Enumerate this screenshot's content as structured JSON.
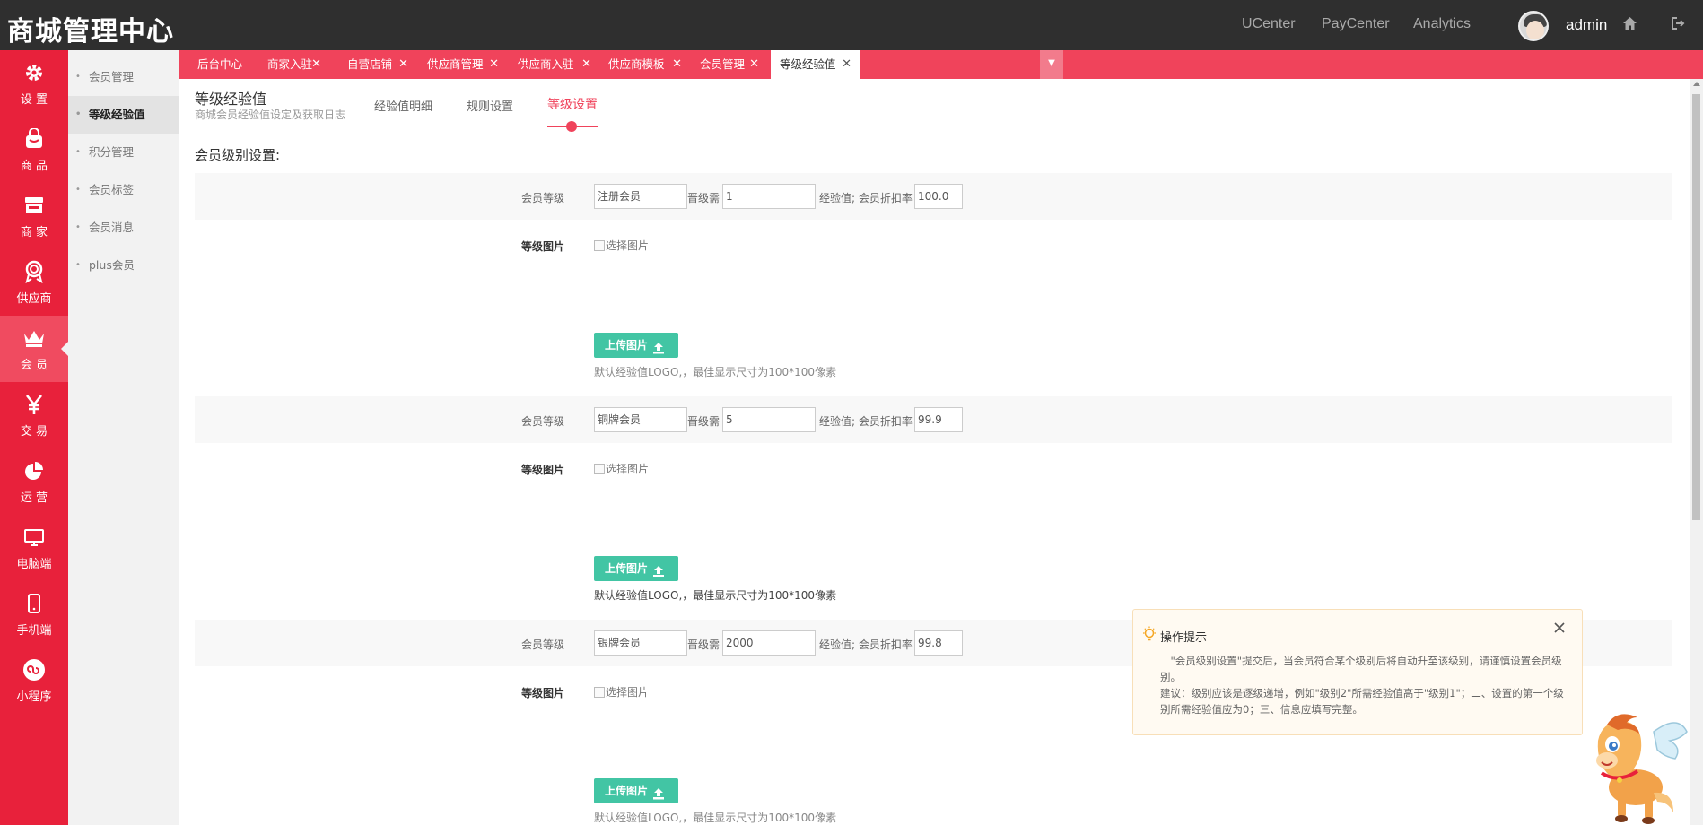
{
  "header": {
    "brand": "商城管理中心",
    "nav": [
      "UCenter",
      "PayCenter",
      "Analytics"
    ],
    "username": "admin"
  },
  "sidebar": {
    "items": [
      {
        "label": "设 置",
        "icon": "gear-icon"
      },
      {
        "label": "商 品",
        "icon": "bag-icon"
      },
      {
        "label": "商 家",
        "icon": "store-icon"
      },
      {
        "label": "供应商",
        "icon": "medal-icon"
      },
      {
        "label": "会 员",
        "icon": "crown-icon"
      },
      {
        "label": "交 易",
        "icon": "yen-icon"
      },
      {
        "label": "运 营",
        "icon": "pie-chart-icon"
      },
      {
        "label": "电脑端",
        "icon": "monitor-icon"
      },
      {
        "label": "手机端",
        "icon": "mobile-icon"
      },
      {
        "label": "小程序",
        "icon": "mini-program-icon"
      }
    ],
    "active_index": 4
  },
  "submenu": {
    "items": [
      "会员管理",
      "等级经验值",
      "积分管理",
      "会员标签",
      "会员消息",
      "plus会员"
    ],
    "active_index": 1
  },
  "tabs": {
    "items": [
      "后台中心",
      "商家入驻",
      "自营店铺",
      "供应商管理",
      "供应商入驻",
      "供应商模板",
      "会员管理",
      "等级经验值"
    ],
    "active_index": 7
  },
  "page": {
    "title": "等级经验值",
    "description": "商城会员经验值设定及获取日志",
    "sub_tabs": [
      "经验值明细",
      "规则设置",
      "等级设置"
    ],
    "active_sub_tab": 2,
    "section_title": "会员级别设置:"
  },
  "form": {
    "level_label": "会员等级",
    "upgrade_label": "晋级需",
    "exp_discount_label": "经验值; 会员折扣率",
    "image_label": "等级图片",
    "image_alt": "选择图片",
    "upload_label": "上传图片",
    "hint": "默认经验值LOGO,，最佳显示尺寸为100*100像素",
    "levels": [
      {
        "name": "注册会员",
        "exp": "1",
        "discount": "100.0"
      },
      {
        "name": "铜牌会员",
        "exp": "5",
        "discount": "99.9"
      },
      {
        "name": "银牌会员",
        "exp": "2000",
        "discount": "99.8"
      }
    ]
  },
  "tip": {
    "title": "操作提示",
    "line1": "\"会员级别设置\"提交后，当会员符合某个级别后将自动升至该级别，请谨慎设置会员级别。",
    "line2": "建议：级别应该是逐级递增，例如\"级别2\"所需经验值高于\"级别1\"；二、设置的第一个级别所需经验值应为0；三、信息应填写完整。"
  },
  "colors": {
    "topbar": "#2f2f2f",
    "sidebar": "#e8213b",
    "tabbar": "#f0435b",
    "upload_button": "#42c5a4",
    "accent": "#f0435b"
  }
}
